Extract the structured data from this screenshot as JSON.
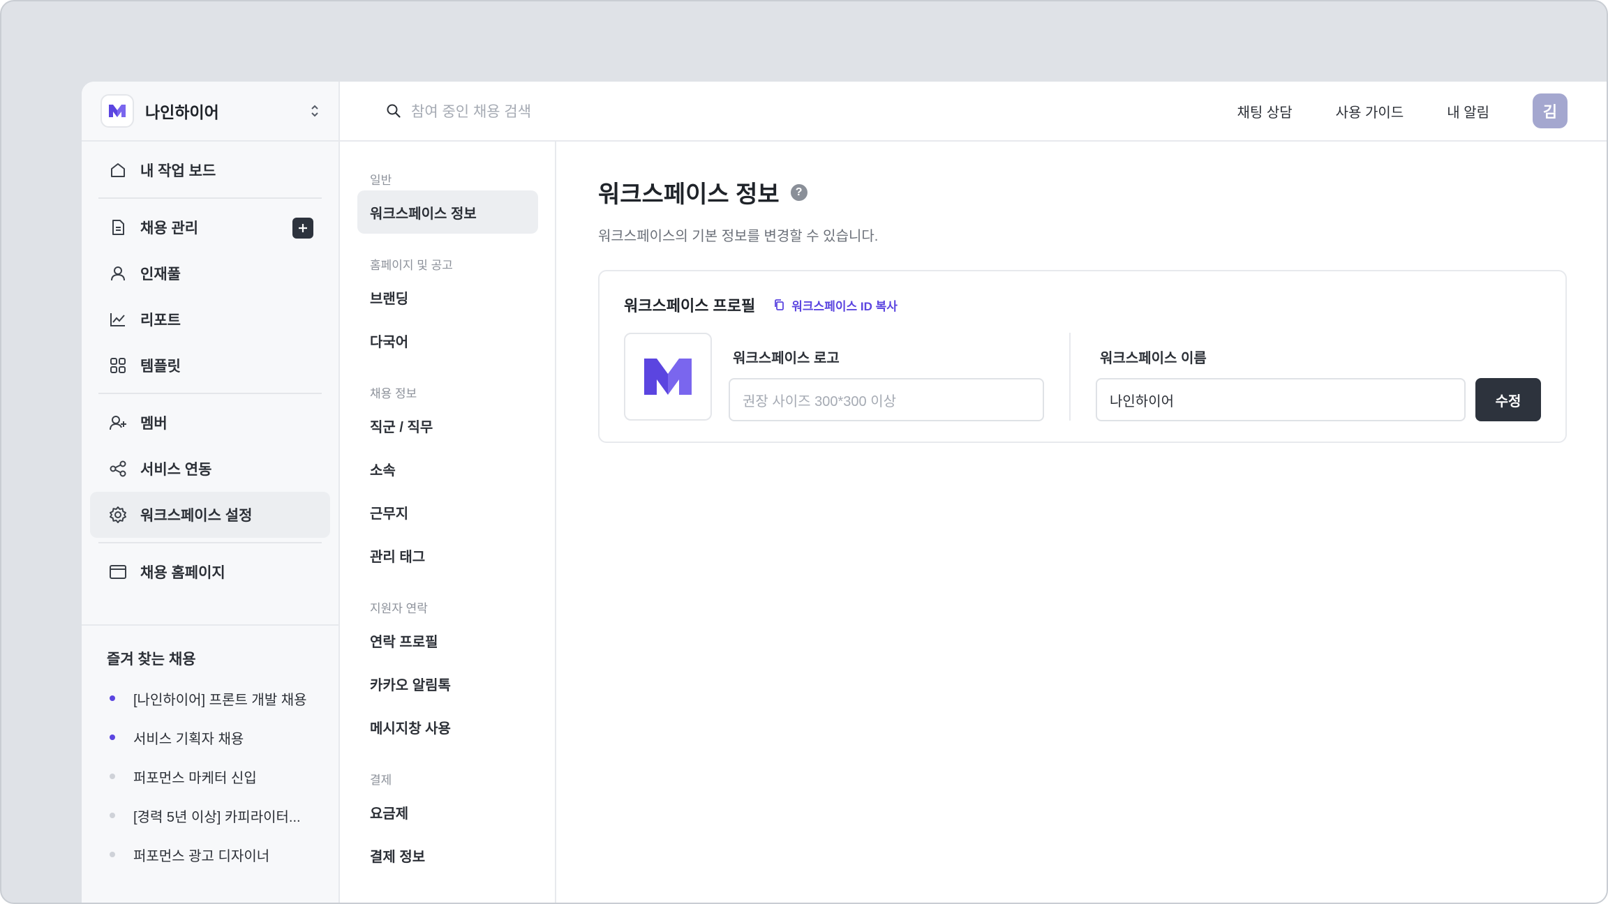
{
  "workspace": {
    "name": "나인하이어"
  },
  "nav": {
    "items": [
      {
        "label": "내 작업 보드",
        "icon": "home-icon"
      },
      {
        "label": "채용 관리",
        "icon": "document-icon"
      },
      {
        "label": "인재풀",
        "icon": "user-icon"
      },
      {
        "label": "리포트",
        "icon": "chart-line-icon"
      },
      {
        "label": "템플릿",
        "icon": "grid-icon"
      },
      {
        "label": "멤버",
        "icon": "user-plus-icon"
      },
      {
        "label": "서비스 연동",
        "icon": "share-icon"
      },
      {
        "label": "워크스페이스 설정",
        "icon": "gear-icon"
      },
      {
        "label": "채용 홈페이지",
        "icon": "browser-icon"
      }
    ]
  },
  "favorites": {
    "title": "즐겨 찾는 채용",
    "items": [
      {
        "label": "[나인하이어] 프론트 개발 채용",
        "active": true
      },
      {
        "label": "서비스 기획자 채용",
        "active": true
      },
      {
        "label": "퍼포먼스 마케터 신입",
        "active": false
      },
      {
        "label": "[경력 5년 이상] 카피라이터...",
        "active": false
      },
      {
        "label": "퍼포먼스 광고 디자이너",
        "active": false
      }
    ]
  },
  "topbar": {
    "search_placeholder": "참여 중인 채용 검색",
    "links": [
      "채팅 상담",
      "사용 가이드",
      "내 알림"
    ],
    "avatar_initial": "김"
  },
  "settings_menu": {
    "groups": [
      {
        "title": "일반",
        "items": [
          "워크스페이스 정보"
        ]
      },
      {
        "title": "홈페이지 및 공고",
        "items": [
          "브랜딩",
          "다국어"
        ]
      },
      {
        "title": "채용 정보",
        "items": [
          "직군 / 직무",
          "소속",
          "근무지",
          "관리 태그"
        ]
      },
      {
        "title": "지원자 연락",
        "items": [
          "연락 프로필",
          "카카오 알림톡",
          "메시지창 사용"
        ]
      },
      {
        "title": "결제",
        "items": [
          "요금제",
          "결제 정보"
        ]
      }
    ]
  },
  "main": {
    "title": "워크스페이스 정보",
    "subtitle": "워크스페이스의 기본 정보를 변경할 수 있습니다.",
    "card": {
      "title": "워크스페이스 프로필",
      "copy_link": "워크스페이스 ID 복사",
      "logo_label": "워크스페이스 로고",
      "logo_placeholder": "권장 사이즈 300*300 이상",
      "name_label": "워크스페이스 이름",
      "name_value": "나인하이어",
      "edit_button": "수정"
    }
  },
  "colors": {
    "brand": "#5b45e0",
    "dark_button": "#2d333d",
    "avatar": "#a4a7cf"
  }
}
